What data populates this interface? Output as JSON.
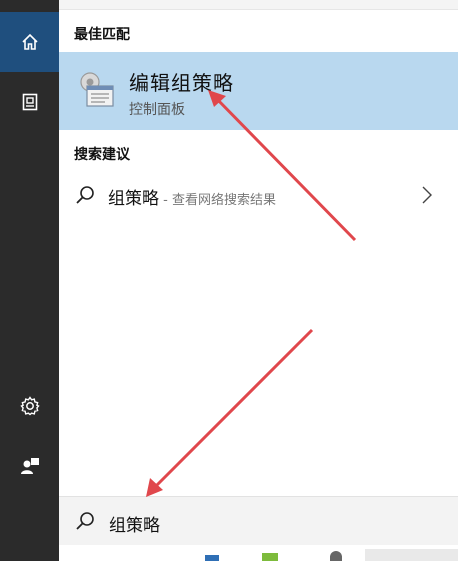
{
  "left_rail": {
    "items": [
      {
        "icon": "home-icon",
        "active": true
      },
      {
        "icon": "tablet-icon",
        "active": false
      },
      {
        "icon": "gear-icon",
        "active": false
      },
      {
        "icon": "user-icon",
        "active": false
      }
    ]
  },
  "best_match": {
    "heading": "最佳匹配",
    "title": "编辑组策略",
    "subtitle": "控制面板",
    "icon": "group-policy-icon"
  },
  "suggestions": {
    "heading": "搜索建议",
    "items": [
      {
        "label": "组策略",
        "suffix": " - 查看网络搜索结果",
        "icon": "search-icon"
      }
    ]
  },
  "search": {
    "value": "组策略",
    "icon": "search-icon"
  },
  "colors": {
    "highlight": "#b9d8ef",
    "rail": "#2b2b2b",
    "rail_active": "#1f4f7e",
    "arrow": "#e0474c"
  }
}
